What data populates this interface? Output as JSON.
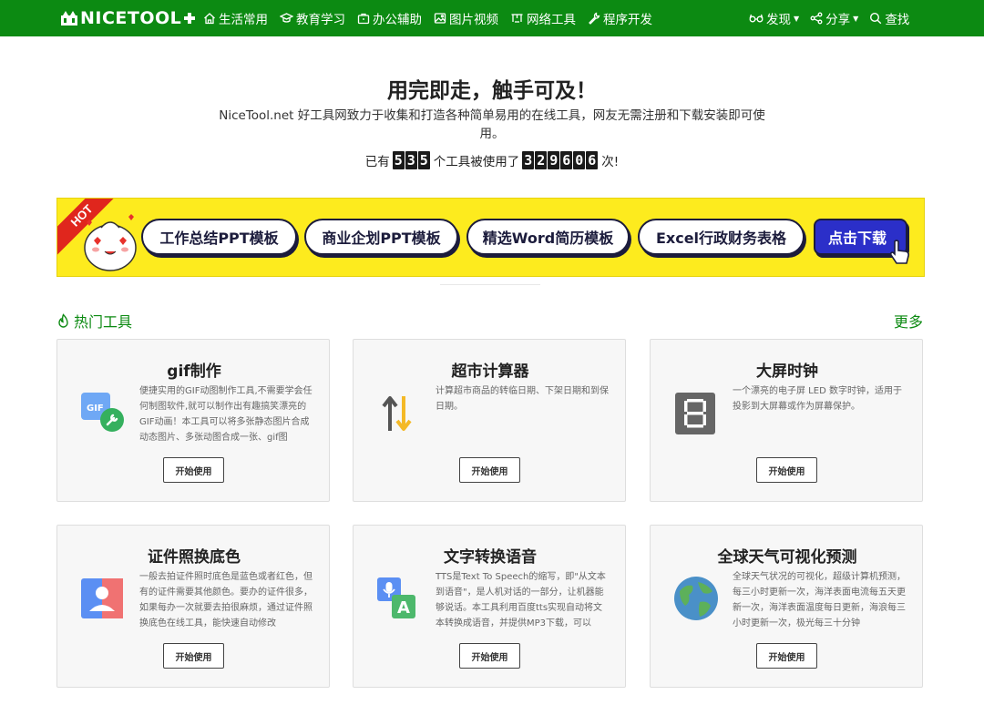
{
  "nav": {
    "logo": "NICETOOL",
    "items": [
      {
        "label": "生活常用",
        "icon": "home-icon"
      },
      {
        "label": "教育学习",
        "icon": "graduation-cap-icon"
      },
      {
        "label": "办公辅助",
        "icon": "briefcase-icon"
      },
      {
        "label": "图片视频",
        "icon": "image-icon"
      },
      {
        "label": "网络工具",
        "icon": "network-icon"
      },
      {
        "label": "程序开发",
        "icon": "wrench-icon"
      }
    ],
    "right": [
      {
        "label": "发现",
        "icon": "glasses-icon"
      },
      {
        "label": "分享",
        "icon": "share-icon"
      },
      {
        "label": "查找",
        "icon": "search-icon"
      }
    ]
  },
  "hero": {
    "title": "用完即走，触手可及！",
    "description": "NiceTool.net 好工具网致力于收集和打造各种简单易用的在线工具，网友无需注册和下载安装即可使用。",
    "stats_prefix": "已有",
    "tool_count": "535",
    "stats_middle": "个工具被使用了",
    "use_count": "329606",
    "stats_suffix": "次!"
  },
  "banner": {
    "hot_label": "HOT",
    "pills": [
      "工作总结PPT模板",
      "商业企划PPT模板",
      "精选Word简历模板",
      "Excel行政财务表格"
    ],
    "download_label": "点击下载"
  },
  "section": {
    "title": "热门工具",
    "more": "更多"
  },
  "cards": [
    {
      "title": "gif制作",
      "icon": "gif-icon",
      "desc": "便捷实用的GIF动图制作工具,不需要学会任何制图软件,就可以制作出有趣搞笑漂亮的GIF动画！本工具可以将多张静态图片合成动态图片、多张动图合成一张、gif图",
      "button": "开始使用"
    },
    {
      "title": "超市计算器",
      "icon": "up-down-arrows-icon",
      "desc": "计算超市商品的转临日期、下架日期和到保日期。",
      "button": "开始使用"
    },
    {
      "title": "大屏时钟",
      "icon": "digital-eight-icon",
      "desc": "一个漂亮的电子屏 LED 数字时钟，适用于投影到大屏幕或作为屏幕保护。",
      "button": "开始使用"
    },
    {
      "title": "证件照换底色",
      "icon": "id-photo-icon",
      "desc": "一般去拍证件照时底色是蓝色或者红色，但有的证件需要其他颜色。要办的证件很多，如果每办一次就要去拍很麻烦，通过证件照换底色在线工具，能快速自动修改",
      "button": "开始使用"
    },
    {
      "title": "文字转换语音",
      "icon": "text-to-speech-icon",
      "desc": "TTS是Text To Speech的缩写，即\"从文本到语音\"，是人机对话的一部分，让机器能够说话。本工具利用百度tts实现自动将文本转换成语音，并提供MP3下载，可以",
      "button": "开始使用"
    },
    {
      "title": "全球天气可视化预测",
      "icon": "globe-icon",
      "desc": "全球天气状况的可视化，超级计算机预测，每三小时更新一次，海洋表面电流每五天更新一次，海洋表面温度每日更新，海浪每三小时更新一次，极光每三十分钟",
      "button": "开始使用"
    }
  ],
  "colors": {
    "brand_green": "#0c8a12",
    "banner_yellow": "#fdeb1e",
    "download_blue": "#2b2fc9",
    "hot_red": "#e0261d"
  }
}
